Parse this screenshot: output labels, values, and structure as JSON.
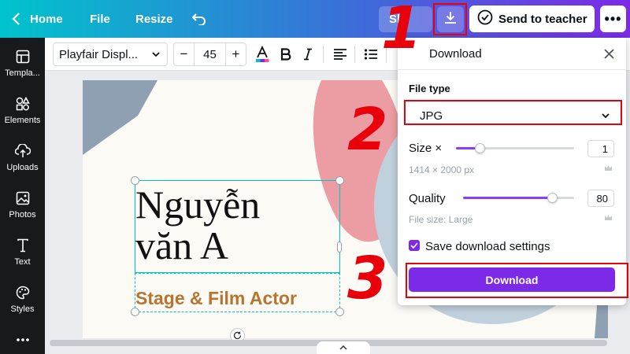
{
  "topbar": {
    "home_label": "Home",
    "file_label": "File",
    "resize_label": "Resize",
    "share_label": "Sh",
    "teacher_label": "Send to teacher",
    "more_label": "•••"
  },
  "sidebar": {
    "items": [
      {
        "label": "Templa...",
        "icon": "templates-icon"
      },
      {
        "label": "Elements",
        "icon": "elements-icon"
      },
      {
        "label": "Uploads",
        "icon": "upload-icon"
      },
      {
        "label": "Photos",
        "icon": "photos-icon"
      },
      {
        "label": "Text",
        "icon": "text-icon"
      },
      {
        "label": "Styles",
        "icon": "styles-icon"
      }
    ]
  },
  "toolbar": {
    "font_name": "Playfair Displ...",
    "minus_label": "−",
    "font_size": "45",
    "plus_label": "+"
  },
  "canvas": {
    "headline": "Nguyễn văn A",
    "subhead": "Stage & Film Actor"
  },
  "panel": {
    "title": "Download",
    "file_type_label": "File type",
    "file_type_value": "JPG",
    "size_label": "Size ×",
    "size_value": "1",
    "size_fraction": 0.2,
    "dimensions": "1414 × 2000 px",
    "quality_label": "Quality",
    "quality_value": "80",
    "quality_fraction": 0.8,
    "file_size_hint": "File size: Large",
    "save_settings_label": "Save download settings",
    "save_settings_checked": true,
    "download_label": "Download"
  },
  "annotations": {
    "step1": "1",
    "step2": "2",
    "step3": "3"
  },
  "colors": {
    "accent": "#7d2ae8",
    "highlight": "#e8000b",
    "selection": "#00c4cc"
  }
}
